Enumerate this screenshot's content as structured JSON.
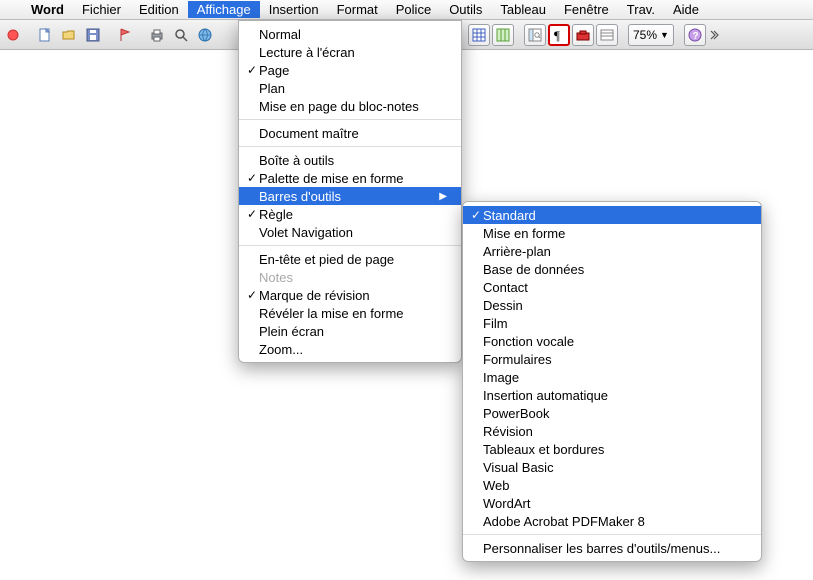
{
  "menubar": {
    "items": [
      {
        "label": "Word",
        "bold": true
      },
      {
        "label": "Fichier"
      },
      {
        "label": "Edition"
      },
      {
        "label": "Affichage",
        "active": true
      },
      {
        "label": "Insertion"
      },
      {
        "label": "Format"
      },
      {
        "label": "Police"
      },
      {
        "label": "Outils"
      },
      {
        "label": "Tableau"
      },
      {
        "label": "Fenêtre"
      },
      {
        "label": "Trav."
      },
      {
        "label": "Aide"
      }
    ]
  },
  "toolbar": {
    "zoom": "75%"
  },
  "dropdown_affichage": {
    "items": [
      {
        "label": "Normal"
      },
      {
        "label": "Lecture à l'écran"
      },
      {
        "label": "Page",
        "checked": true
      },
      {
        "label": "Plan"
      },
      {
        "label": "Mise en page du bloc-notes"
      },
      {
        "sep": true
      },
      {
        "label": "Document maître"
      },
      {
        "sep": true
      },
      {
        "label": "Boîte à outils"
      },
      {
        "label": "Palette de mise en forme",
        "checked": true
      },
      {
        "label": "Barres d'outils",
        "submenu": true,
        "highlight": true
      },
      {
        "label": "Règle",
        "checked": true
      },
      {
        "label": "Volet Navigation"
      },
      {
        "sep": true
      },
      {
        "label": "En-tête et pied de page"
      },
      {
        "label": "Notes",
        "disabled": true
      },
      {
        "label": "Marque de révision",
        "checked": true
      },
      {
        "label": "Révéler la mise en forme"
      },
      {
        "label": "Plein écran"
      },
      {
        "label": "Zoom..."
      }
    ]
  },
  "dropdown_toolbars": {
    "items": [
      {
        "label": "Standard",
        "checked": true,
        "highlight": true
      },
      {
        "label": "Mise en forme"
      },
      {
        "label": "Arrière-plan"
      },
      {
        "label": "Base de données"
      },
      {
        "label": "Contact"
      },
      {
        "label": "Dessin"
      },
      {
        "label": "Film"
      },
      {
        "label": "Fonction vocale"
      },
      {
        "label": "Formulaires"
      },
      {
        "label": "Image"
      },
      {
        "label": "Insertion automatique"
      },
      {
        "label": "PowerBook"
      },
      {
        "label": "Révision"
      },
      {
        "label": "Tableaux et bordures"
      },
      {
        "label": "Visual Basic"
      },
      {
        "label": "Web"
      },
      {
        "label": "WordArt"
      },
      {
        "label": "Adobe Acrobat PDFMaker 8"
      },
      {
        "sep": true
      },
      {
        "label": "Personnaliser les barres d'outils/menus..."
      }
    ]
  }
}
